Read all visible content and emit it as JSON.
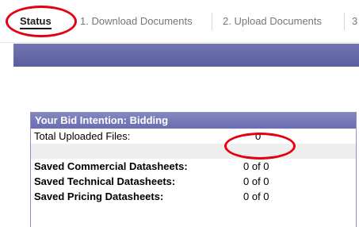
{
  "tabs": [
    {
      "label": "Status",
      "active": true
    },
    {
      "label": "1. Download Documents",
      "active": false
    },
    {
      "label": "2. Upload Documents",
      "active": false
    },
    {
      "label": "3",
      "active": false
    }
  ],
  "panel": {
    "title": "Your Bid Intention: Bidding",
    "total_uploaded": {
      "label": "Total Uploaded Files:",
      "value": "0"
    },
    "datasheets": [
      {
        "label": "Saved Commercial Datasheets:",
        "value": "0 of 0"
      },
      {
        "label": "Saved Technical Datasheets:",
        "value": "0 of 0"
      },
      {
        "label": "Saved Pricing Datasheets:",
        "value": "0 of 0"
      }
    ]
  },
  "colors": {
    "band": "#5b5e9d",
    "panel_header": "#6a6db0",
    "annotation": "#e3000f"
  }
}
